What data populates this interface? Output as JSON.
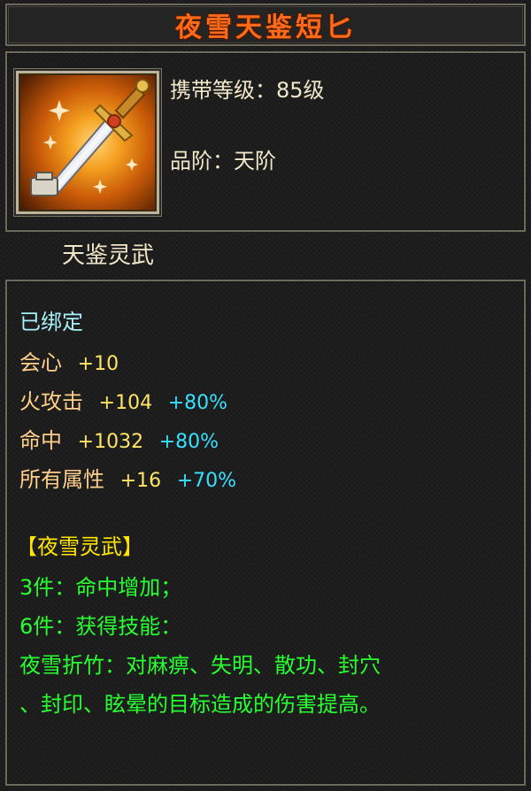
{
  "item": {
    "name": "夜雪天鉴短匕",
    "carry_level": "携带等级：85级",
    "grade": "品阶：天阶",
    "category": "天鉴灵武",
    "icon": "dagger-icon"
  },
  "attributes": {
    "bound": "已绑定",
    "stats": [
      {
        "name": "会心",
        "value": "+10",
        "percent": ""
      },
      {
        "name": "火攻击",
        "value": "+104",
        "percent": "+80%"
      },
      {
        "name": "命中",
        "value": "+1032",
        "percent": "+80%"
      },
      {
        "name": "所有属性",
        "value": "+16",
        "percent": "+70%"
      }
    ]
  },
  "set": {
    "title": "【夜雪灵武】",
    "bonus_3": "3件：命中增加；",
    "bonus_6": "6件：获得技能：",
    "skill_line1": "夜雪折竹：对麻痹、失明、散功、封穴",
    "skill_line2": "、封印、眩晕的目标造成的伤害提高。"
  },
  "colors": {
    "title": "#ff6a1a",
    "bound": "#a8f0f8",
    "stat_name": "#ffcf8a",
    "stat_value": "#ffe466",
    "percent": "#38e0ff",
    "set_title": "#ffe600",
    "set_text": "#28ff30"
  }
}
